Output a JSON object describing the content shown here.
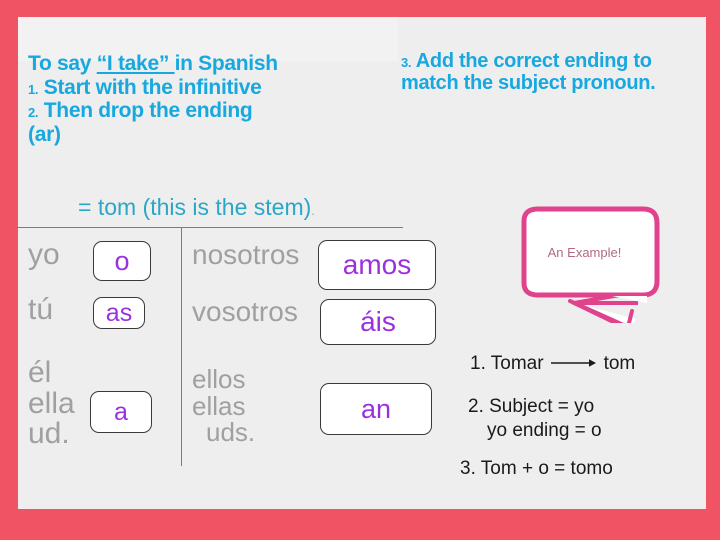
{
  "slide": {
    "frame_color": "#f05464",
    "canvas_color": "#eeeeee",
    "heading_color": "#17a8e0",
    "stem_color": "#2ba7c6",
    "pronoun_color": "#a0a0a0",
    "ending_color": "#9b30e0",
    "rule_color": "#a259c8",
    "bubble_color": "#e0438c"
  },
  "heading_left": {
    "line1_a": "To say ",
    "line1_quote": "“I take” ",
    "line1_b": "in Spanish",
    "line2_num": "1.",
    "line2_text": " Start with the infinitive",
    "line3_num": "2.",
    "line3_text": " Then drop the ending",
    "line4": "(ar)"
  },
  "heading_right": {
    "num": "3.",
    "text": " Add the correct ending to match the subject pronoun."
  },
  "stem": {
    "text": "= tom (this is the stem)",
    "trailing_dot": "."
  },
  "table": {
    "rows": [
      {
        "pronoun": "yo",
        "ending": "o"
      },
      {
        "pronoun": "tú",
        "ending": "as"
      },
      {
        "pronoun_lines": [
          "él",
          "ella",
          "ud."
        ],
        "ending": "a"
      },
      {
        "pronoun": "nosotros",
        "ending": "amos"
      },
      {
        "pronoun": "vosotros",
        "ending": "áis"
      },
      {
        "pronoun_lines": [
          "ellos",
          "ellas",
          "uds."
        ],
        "ending": "an"
      }
    ],
    "pronoun_yo": "yo",
    "pronoun_tu": "tú",
    "pronoun_el_1": "él",
    "pronoun_el_2": "ella",
    "pronoun_el_3": "ud.",
    "pronoun_nosotros": "nosotros",
    "pronoun_vosotros": "vosotros",
    "pronoun_ellos_1": "ellos",
    "pronoun_ellos_2": "ellas",
    "pronoun_ellos_3": "uds.",
    "ending_o": "o",
    "ending_as": "as",
    "ending_a": "a",
    "ending_amos": "amos",
    "ending_ais": "áis",
    "ending_an": "an"
  },
  "bubble": {
    "label": "An Example!"
  },
  "example": {
    "line1_pre": "1. Tomar",
    "line1_post": "tom",
    "line2": "2. Subject = yo",
    "line3": "yo ending = o",
    "line4": "3. Tom + o = tomo"
  }
}
